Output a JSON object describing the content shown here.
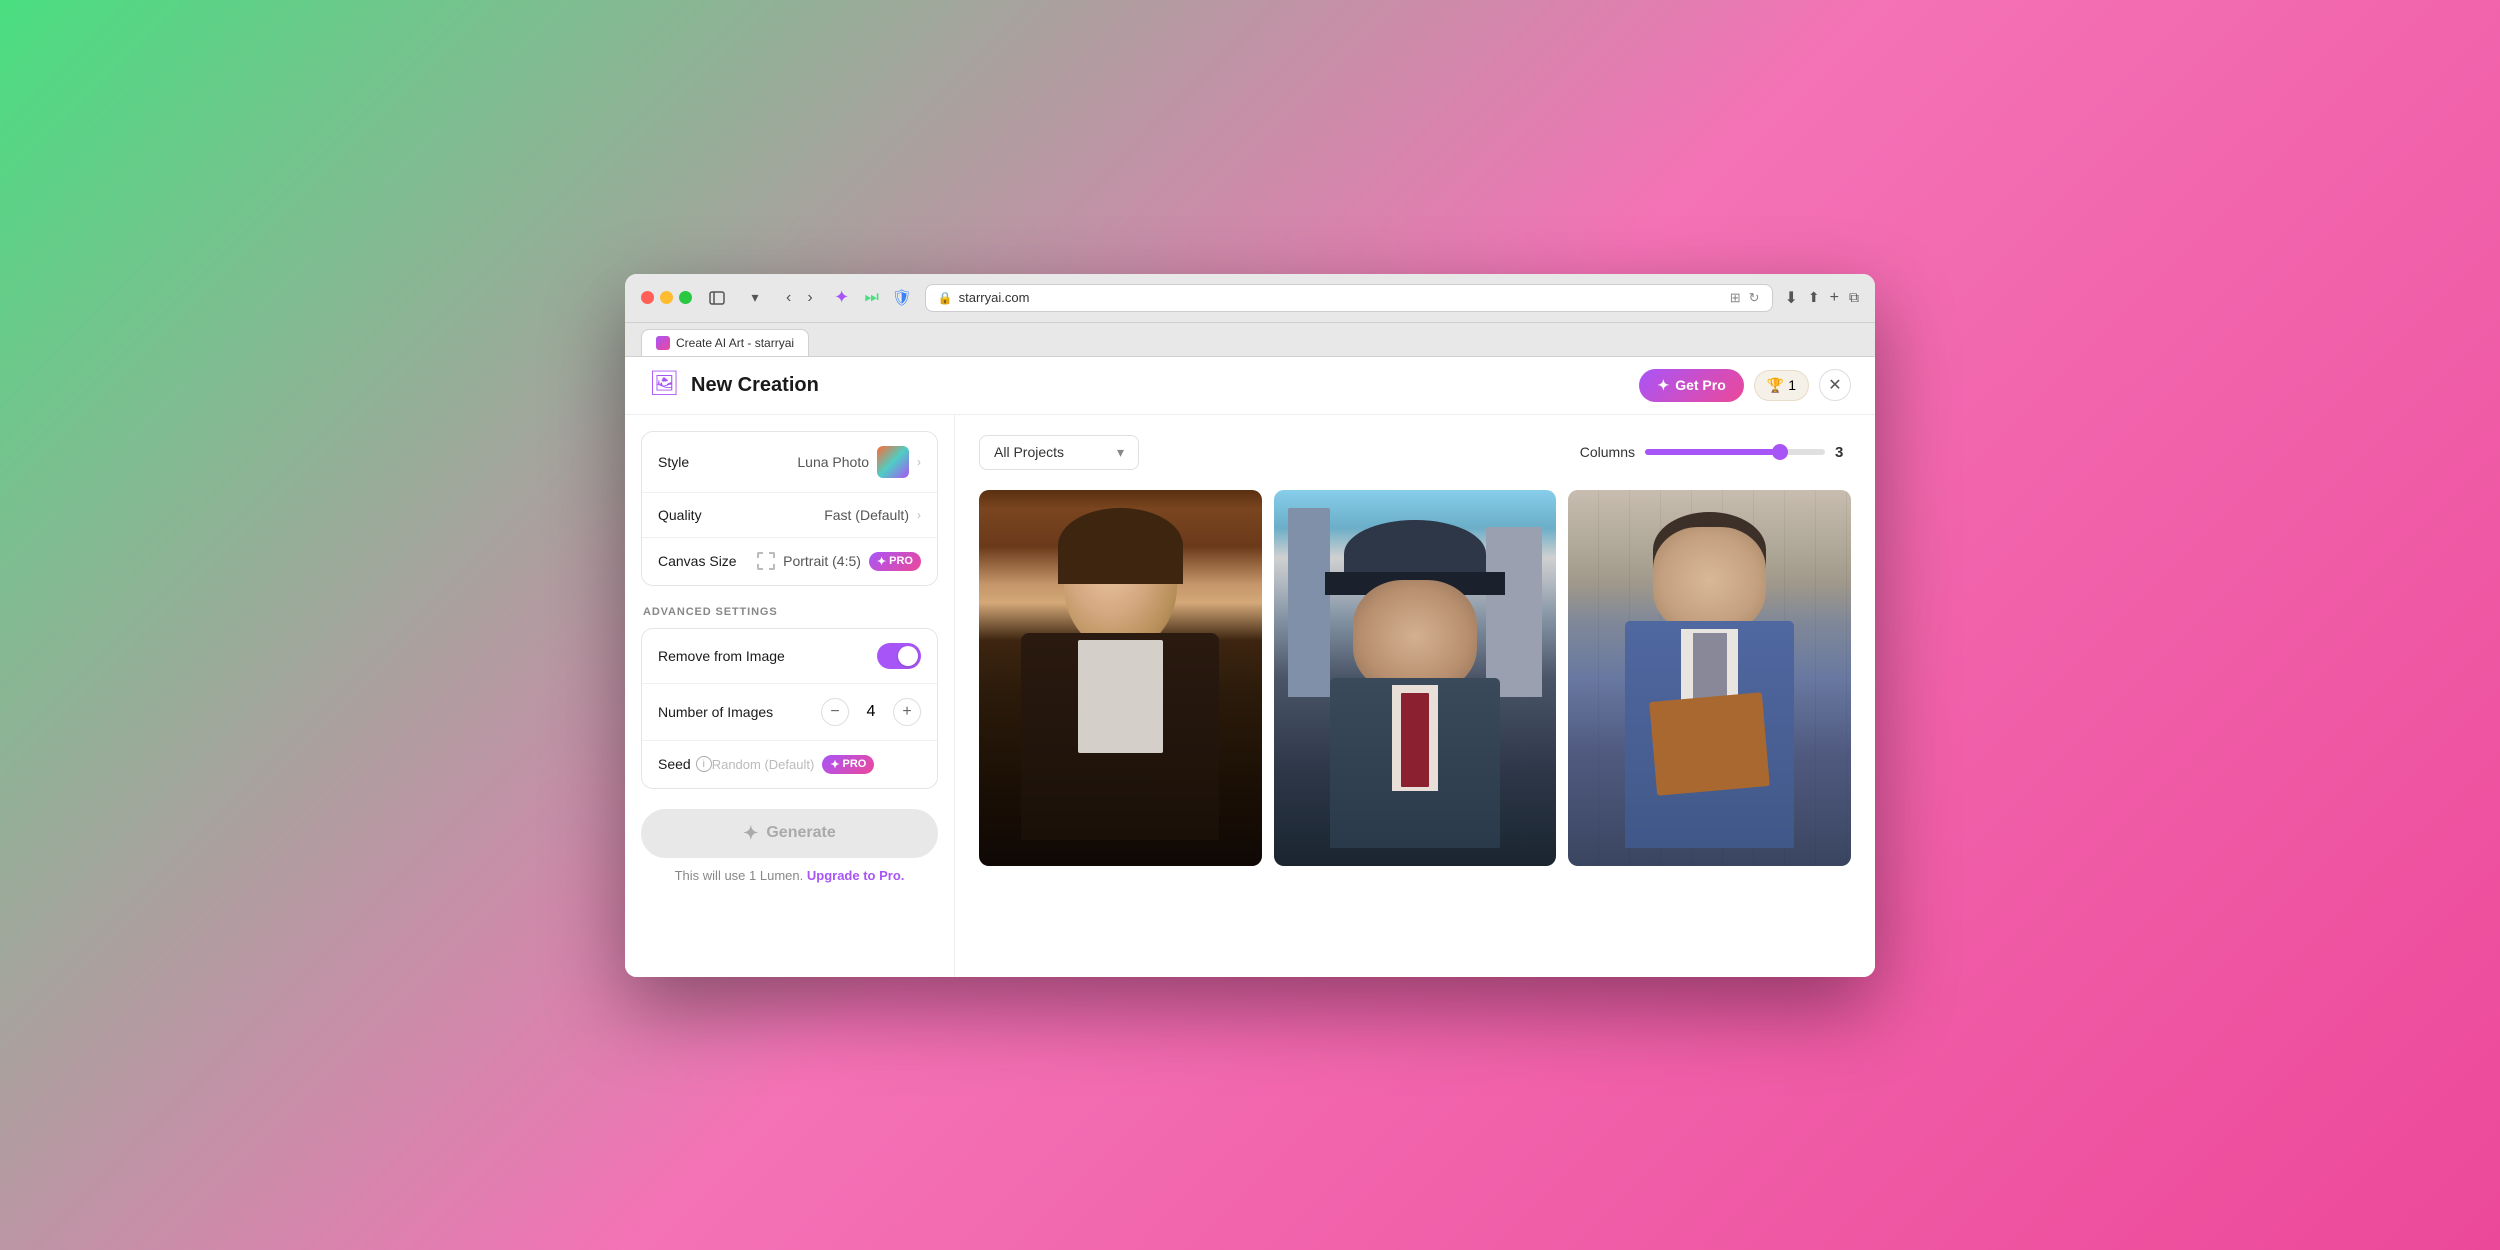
{
  "browser": {
    "url": "starryai.com",
    "tab_title": "Create AI Art - starryai",
    "nav": {
      "back_label": "‹",
      "forward_label": "›"
    }
  },
  "header": {
    "title": "New Creation",
    "get_pro_label": "Get Pro",
    "lumen_count": "1",
    "close_label": "✕"
  },
  "sidebar": {
    "style_label": "Style",
    "style_value": "Luna Photo",
    "quality_label": "Quality",
    "quality_value": "Fast (Default)",
    "canvas_size_label": "Canvas Size",
    "canvas_size_value": "Portrait (4:5)",
    "advanced_settings_title": "ADVANCED SETTINGS",
    "remove_from_image_label": "Remove from Image",
    "toggle_state": "on",
    "num_images_label": "Number of Images",
    "num_images_value": "4",
    "seed_label": "Seed",
    "seed_placeholder": "Random (Default)",
    "generate_label": "Generate",
    "lumen_notice": "This will use 1 Lumen.",
    "upgrade_label": "Upgrade to Pro."
  },
  "gallery": {
    "projects_label": "All Projects",
    "columns_label": "Columns",
    "columns_value": "3",
    "images": [
      {
        "id": 1,
        "alt": "Man in leather jacket with glasses"
      },
      {
        "id": 2,
        "alt": "Man in suit with hat on city street"
      },
      {
        "id": 3,
        "alt": "Man in suit holding book"
      }
    ]
  }
}
